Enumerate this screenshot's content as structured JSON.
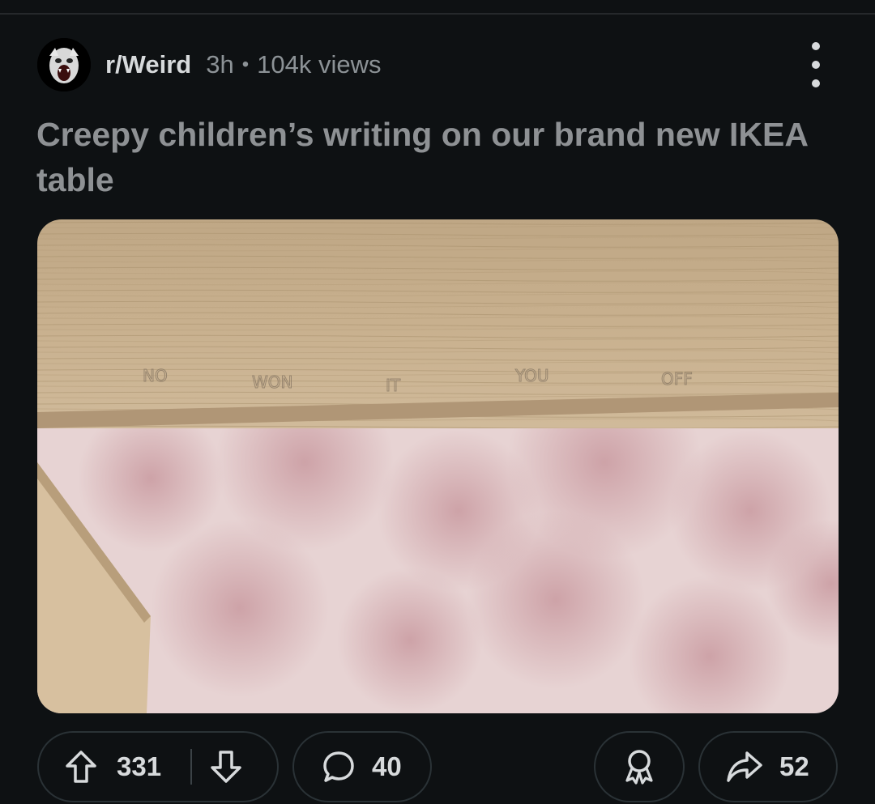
{
  "post": {
    "subreddit": "r/Weird",
    "age": "3h",
    "separator": "•",
    "views": "104k views",
    "title": "Creepy children’s writing on our brand new IKEA table"
  },
  "image": {
    "engraved_words": [
      "NO",
      "WON",
      "IT",
      "YOU",
      "OFF"
    ]
  },
  "actions": {
    "upvotes": "331",
    "comments": "40",
    "shares": "52"
  },
  "icons": {
    "menu": "more-vertical-icon",
    "upvote": "arrow-up-icon",
    "downvote": "arrow-down-icon",
    "comment": "speech-bubble-icon",
    "award": "award-ribbon-icon",
    "share": "share-arrow-icon"
  },
  "colors": {
    "background": "#0e1113",
    "text": "#d7dadc",
    "muted": "#8c9296",
    "title": "#8e9194",
    "border": "#2a3236",
    "wood": "#c8b08c",
    "carpet": "#d9b3b6"
  }
}
